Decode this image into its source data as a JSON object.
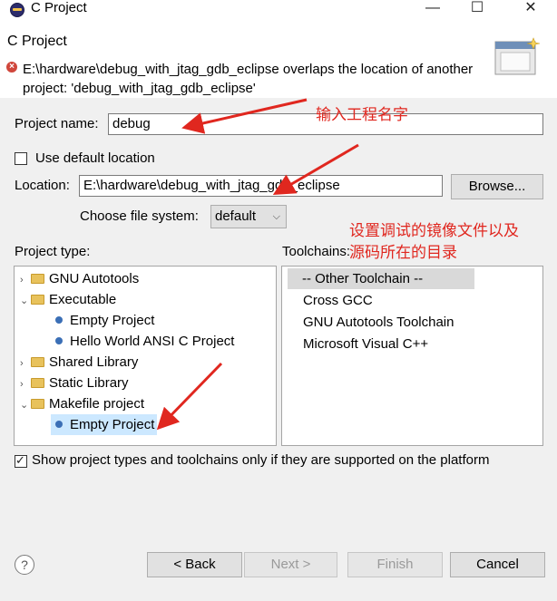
{
  "window": {
    "title": "C Project",
    "minimize_glyph": "—",
    "maximize_glyph": "☐",
    "close_glyph": "✕"
  },
  "header": {
    "wizard_title": "C Project",
    "error_message": "E:\\hardware\\debug_with_jtag_gdb_eclipse overlaps the location of another project: 'debug_with_jtag_gdb_eclipse'",
    "error_icon": "error-icon"
  },
  "form": {
    "project_name_label": "Project name:",
    "project_name_value": "debug",
    "use_default_location_label": "Use default location",
    "use_default_location_checked": false,
    "location_label": "Location:",
    "location_value": "E:\\hardware\\debug_with_jtag_gdb_eclipse",
    "browse_label": "Browse...",
    "file_system_label": "Choose file system:",
    "file_system_value": "default"
  },
  "project_type": {
    "label": "Project type:",
    "items": [
      {
        "label": "GNU Autotools",
        "kind": "folder",
        "expanded": false
      },
      {
        "label": "Executable",
        "kind": "folder",
        "expanded": true
      },
      {
        "label": "Empty Project",
        "kind": "leaf"
      },
      {
        "label": "Hello World ANSI C Project",
        "kind": "leaf"
      },
      {
        "label": "Shared Library",
        "kind": "folder",
        "expanded": false
      },
      {
        "label": "Static Library",
        "kind": "folder",
        "expanded": false
      },
      {
        "label": "Makefile project",
        "kind": "folder",
        "expanded": true
      },
      {
        "label": "Empty Project",
        "kind": "leaf",
        "selected": true
      }
    ]
  },
  "toolchains": {
    "label": "Toolchains:",
    "items": [
      {
        "label": "-- Other Toolchain --",
        "selected": true
      },
      {
        "label": "Cross GCC"
      },
      {
        "label": "GNU Autotools Toolchain"
      },
      {
        "label": "Microsoft Visual C++"
      }
    ]
  },
  "filter": {
    "label": "Show project types and toolchains only if they are supported on the platform",
    "checked": true
  },
  "buttons": {
    "back": "< Back",
    "next": "Next >",
    "finish": "Finish",
    "cancel": "Cancel",
    "help": "?"
  },
  "annotations": {
    "note1": "输入工程名字",
    "note2_line1": "设置调试的镜像文件以及",
    "note2_line2": "源码所在的目录",
    "color": "#e0271f"
  }
}
